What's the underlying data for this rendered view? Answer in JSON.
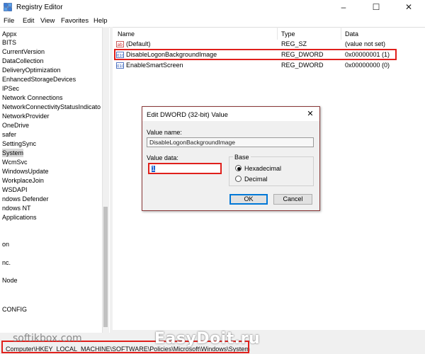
{
  "window": {
    "title": "Registry Editor",
    "controls": [
      "–",
      "☐",
      "✕"
    ]
  },
  "menu": [
    "File",
    "Edit",
    "View",
    "Favorites",
    "Help"
  ],
  "tree": {
    "items": [
      "Appx",
      "BITS",
      "CurrentVersion",
      "DataCollection",
      "DeliveryOptimization",
      "EnhancedStorageDevices",
      "IPSec",
      "Network Connections",
      "NetworkConnectivityStatusIndicato",
      "NetworkProvider",
      "OneDrive",
      "safer",
      "SettingSync",
      "System",
      "WcmSvc",
      "WindowsUpdate",
      "WorkplaceJoin",
      "WSDAPI",
      "ndows Defender",
      "ndows NT",
      "Applications",
      "",
      "on",
      "",
      "nc.",
      "",
      "Node",
      "",
      "CONFIG"
    ],
    "selected": "System"
  },
  "values": {
    "headers": {
      "name": "Name",
      "type": "Type",
      "data": "Data"
    },
    "rows": [
      {
        "name": "(Default)",
        "type": "REG_SZ",
        "data": "(value not set)",
        "icon": "reg-sz-icon"
      },
      {
        "name": "DisableLogonBackgroundImage",
        "type": "REG_DWORD",
        "data": "0x00000001 (1)",
        "icon": "reg-dword-icon"
      },
      {
        "name": "EnableSmartScreen",
        "type": "REG_DWORD",
        "data": "0x00000000 (0)",
        "icon": "reg-dword-icon"
      }
    ]
  },
  "dialog": {
    "title": "Edit DWORD (32-bit) Value",
    "value_name_label": "Value name:",
    "value_name": "DisableLogonBackgroundImage",
    "value_data_label": "Value data:",
    "value_data": "1",
    "base_label": "Base",
    "base_options": [
      "Hexadecimal",
      "Decimal"
    ],
    "base_selected": "Hexadecimal",
    "ok": "OK",
    "cancel": "Cancel",
    "close": "✕"
  },
  "status": {
    "path": "Computer\\HKEY_LOCAL_MACHINE\\SOFTWARE\\Policies\\Microsoft\\Windows\\System"
  },
  "watermarks": {
    "left": "softikbox.com",
    "right": "EasyDoit.ru"
  },
  "colors": {
    "highlight": "#e0201c",
    "accent": "#0078d7"
  }
}
